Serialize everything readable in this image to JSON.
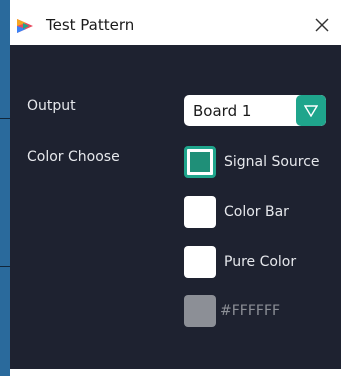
{
  "window": {
    "title": "Test Pattern",
    "close_icon": "close-icon"
  },
  "form": {
    "output_label": "Output",
    "output_value": "Board 1",
    "color_choose_label": "Color Choose",
    "options": [
      {
        "label": "Signal Source",
        "checked": true
      },
      {
        "label": "Color Bar",
        "checked": false
      },
      {
        "label": "Pure Color",
        "checked": false
      },
      {
        "label": "#FFFFFF",
        "checked": false,
        "disabled": true
      }
    ]
  },
  "colors": {
    "dialog_bg": "#1e2230",
    "accent": "#1fa58c",
    "text": "#e6e8ec",
    "disabled": "#8c8f96"
  },
  "icons": {
    "app": "app-logo-icon",
    "dropdown": "chevron-down-icon"
  }
}
